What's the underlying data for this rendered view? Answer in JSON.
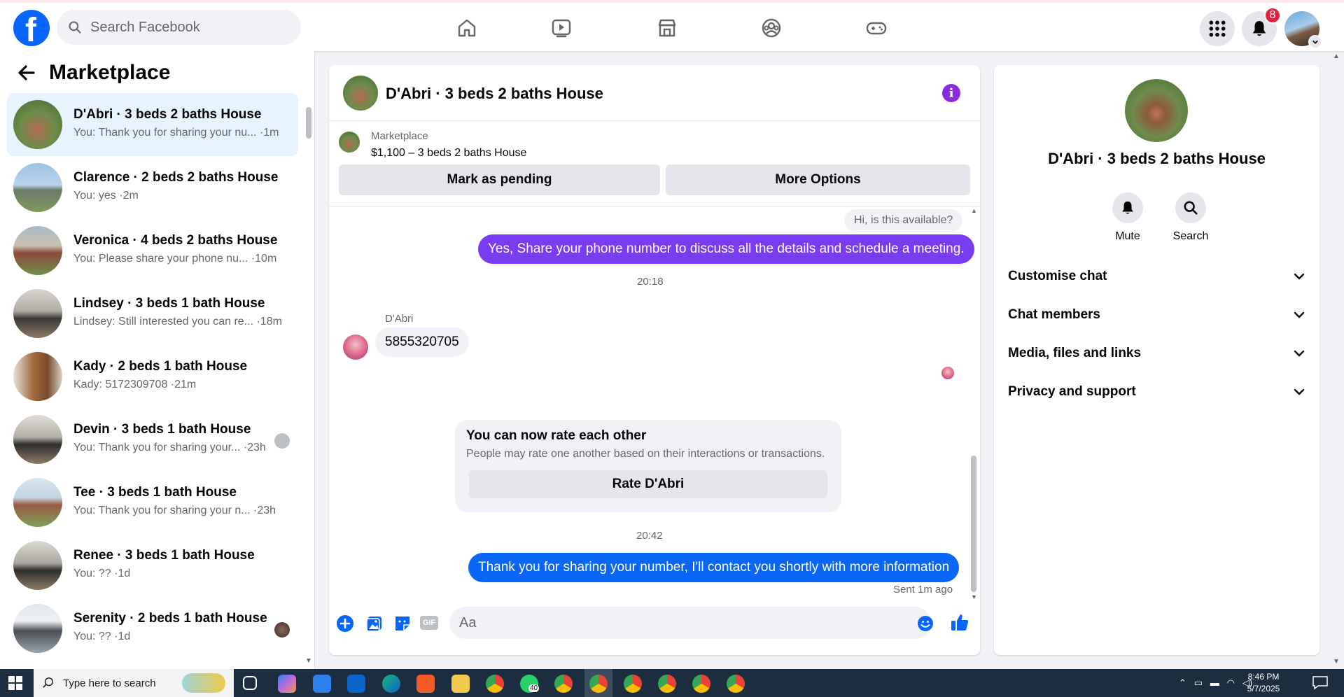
{
  "header": {
    "search_placeholder": "Search Facebook",
    "notification_count": "8",
    "nav": [
      "home-icon",
      "video-icon",
      "marketplace-icon",
      "groups-icon",
      "gaming-icon"
    ]
  },
  "sidebar": {
    "title": "Marketplace",
    "conversations": [
      {
        "title": "D'Abri · 3 beds 2 baths House",
        "preview": "You: Thank you for sharing your nu... ·1m",
        "thumb": "#5a8f45"
      },
      {
        "title": "Clarence · 2 beds 2 baths House",
        "preview": "You: yes ·2m",
        "thumb": "#7ea6c9"
      },
      {
        "title": "Veronica · 4 beds 2 baths House",
        "preview": "You: Please share your phone nu...   ·10m",
        "thumb": "#8a7a64"
      },
      {
        "title": "Lindsey · 3 beds 1 bath House",
        "preview": "Lindsey: Still interested you can re... ·18m",
        "thumb": "#6e6a66"
      },
      {
        "title": "Kady · 2 beds 1 bath House",
        "preview": "Kady: 5172309708 ·21m",
        "thumb": "#9a6e42"
      },
      {
        "title": "Devin · 3 beds 1 bath House",
        "preview": "You: Thank you for sharing your... ·23h",
        "thumb": "#6f6c69"
      },
      {
        "title": "Tee · 3 beds 1 bath House",
        "preview": "You: Thank you for sharing your n... ·23h",
        "thumb": "#8ba36e"
      },
      {
        "title": "Renee · 3 beds 1 bath House",
        "preview": "You: ?? ·1d",
        "thumb": "#7a6f62"
      },
      {
        "title": "Serenity · 2 beds 1 bath House",
        "preview": "You: ?? ·1d",
        "thumb": "#a7b2be"
      }
    ]
  },
  "chat": {
    "title": "D'Abri · 3 beds 2 baths House",
    "listing_source": "Marketplace",
    "listing_price": "$1,100 – 3 beds 2 baths House",
    "btn_pending": "Mark as pending",
    "btn_more": "More Options",
    "msg_in_small": "Hi, is this available?",
    "msg_out_1": "Yes, Share your phone number to discuss all the details and schedule a meeting.",
    "time_1": "20:18",
    "sender_name": "D'Abri",
    "msg_in_phone": "5855320705",
    "rate_title": "You can now rate each other",
    "rate_sub": "People may rate one another based on their interactions or transactions.",
    "rate_btn": "Rate D'Abri",
    "time_2": "20:42",
    "msg_out_2": "Thank you for sharing your number, I'll contact you shortly with more information",
    "sent_status": "Sent 1m ago",
    "composer_placeholder": "Aa"
  },
  "right_panel": {
    "name": "D'Abri · 3 beds 2 baths House",
    "mute_label": "Mute",
    "search_label": "Search",
    "sections": [
      "Customise chat",
      "Chat members",
      "Media, files and links",
      "Privacy and support"
    ]
  },
  "taskbar": {
    "search_placeholder": "Type here to search",
    "time": "8:46 PM",
    "date": "5/7/2025",
    "whatsapp_badge": "40"
  },
  "colors": {
    "brand_blue": "#0866ff",
    "out_bubble_purple": "#7a3cf0",
    "out_bubble_blue": "#0a66f5",
    "notification_red": "#e41e3f"
  }
}
